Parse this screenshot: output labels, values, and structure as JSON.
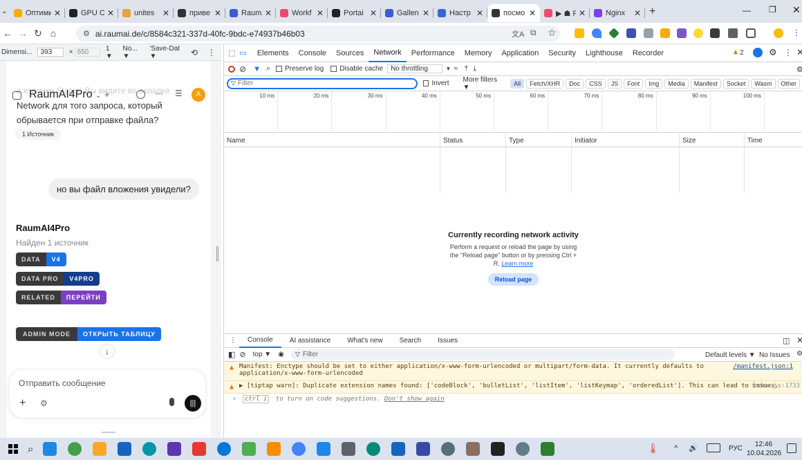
{
  "browser": {
    "tabs": [
      {
        "title": "Оптими",
        "color": "#f9ab00"
      },
      {
        "title": "GPU C",
        "color": "#222"
      },
      {
        "title": "unites",
        "color": "#e8a33a"
      },
      {
        "title": "приве",
        "color": "#333"
      },
      {
        "title": "Raum/",
        "color": "#3e5ccf"
      },
      {
        "title": "Workf",
        "color": "#ea4b71"
      },
      {
        "title": "Portai",
        "color": "#222"
      },
      {
        "title": "Gallen",
        "color": "#3e5ccf"
      },
      {
        "title": "Настр",
        "color": "#3a66d6"
      },
      {
        "title": "посмо",
        "color": "#333"
      },
      {
        "title": "▶ ☗ F",
        "color": "#ea4b71"
      },
      {
        "title": "Nginx",
        "color": "#7b3fe4"
      }
    ],
    "new_tab": "+",
    "url": "ai.raumai.de/c/8584c321-337d-40fc-9bdc-e74937b46b03"
  },
  "device_toolbar": {
    "device": "Dimensi...",
    "width": "393",
    "x": "×",
    "height": "650",
    "dpr": "1 ▼",
    "throttle": "No... ▼",
    "save": "'Save-Dat ▼"
  },
  "chat": {
    "overlay_text": "в колонке Status) Вы видите во вкладке",
    "model_name": "RaumAI4Pro",
    "avatar": "A",
    "assistant_msg": "Network для того запроса, который обрывается при отправке файла?",
    "sources_badge": "1 Источник",
    "user_msg": "но вы файл вложения увидели?",
    "reply_model": "RaumAI4Pro",
    "reply_status": "Найден 1 источник",
    "chips": [
      {
        "a": "DATA",
        "b": "V4",
        "color": "#1a73e8"
      },
      {
        "a": "DATA PRO",
        "b": "V4PRO",
        "color": "#153e8a"
      },
      {
        "a": "RELATED",
        "b": "ПЕРЕЙТИ",
        "color": "#7b3fc4"
      }
    ],
    "admin_chip": {
      "a": "ADMIN MODE",
      "b": "ОТКРЫТЬ ТАБЛИЦУ",
      "color": "#1a73e8"
    },
    "composer_placeholder": "Отправить сообщение"
  },
  "devtools": {
    "panels": [
      "Elements",
      "Console",
      "Sources",
      "Network",
      "Performance",
      "Memory",
      "Application",
      "Security",
      "Lighthouse",
      "Recorder"
    ],
    "warnings_count": "2",
    "preserve_log": "Preserve log",
    "disable_cache": "Disable cache",
    "throttling": "No throttling",
    "filter_placeholder": "Filter",
    "invert": "Invert",
    "more_filters": "More filters ▼",
    "type_filters": [
      "All",
      "Fetch/XHR",
      "Doc",
      "CSS",
      "JS",
      "Font",
      "Img",
      "Media",
      "Manifest",
      "Socket",
      "Wasm",
      "Other"
    ],
    "timeline_ticks": [
      "10 ms",
      "20 ms",
      "30 ms",
      "40 ms",
      "50 ms",
      "60 ms",
      "70 ms",
      "80 ms",
      "90 ms",
      "100 ms"
    ],
    "columns": [
      "Name",
      "Status",
      "Type",
      "Initiator",
      "Size",
      "Time"
    ],
    "empty_title": "Currently recording network activity",
    "empty_line1": "Perform a request or reload the page by using",
    "empty_line2": "the \"Reload page\" button or by pressing Ctrl +",
    "empty_line3_pre": "R.",
    "learn_more": "Learn more",
    "reload_button": "Reload page",
    "drawer_tabs": [
      "Console",
      "AI assistance",
      "What's new",
      "Search",
      "Issues"
    ],
    "context": "top ▼",
    "console_filter": "Filter",
    "default_levels": "Default levels ▼",
    "no_issues": "No Issues",
    "msg1": "Manifest: Enctype should be set to either application/x-www-form-urlencoded or multipart/form-data. It currently defaults to application/x-www-form-urlencoded",
    "msg1_src": "/manifest.json:1",
    "msg2": "▶ [tiptap warn]: Duplicate extension names found: ['codeBlock', 'bulletList', 'listItem', 'listKeymap', 'orderedList']. This can lead to issues.",
    "msg2_src": "index.js:1733",
    "hint_pre": "ctrl i",
    "hint_mid": "to turn on code suggestions.",
    "hint_link": "Don't show again"
  },
  "taskbar": {
    "apps": [
      "#1e88e5",
      "#43a047",
      "#f9a825",
      "#1565c0",
      "#0097a7",
      "#5e35b1",
      "#e53935",
      "#0078d4",
      "#4caf50",
      "#fb8c00",
      "#4285f4",
      "#1e88e5",
      "#5f6368",
      "#00897b",
      "#1565c0",
      "#3949ab",
      "#546e7a",
      "#8d6e63",
      "#222222",
      "#607d8b",
      "#2e7d32"
    ],
    "lang": "РУС",
    "time": "12:46",
    "date": "10.04.2026"
  }
}
